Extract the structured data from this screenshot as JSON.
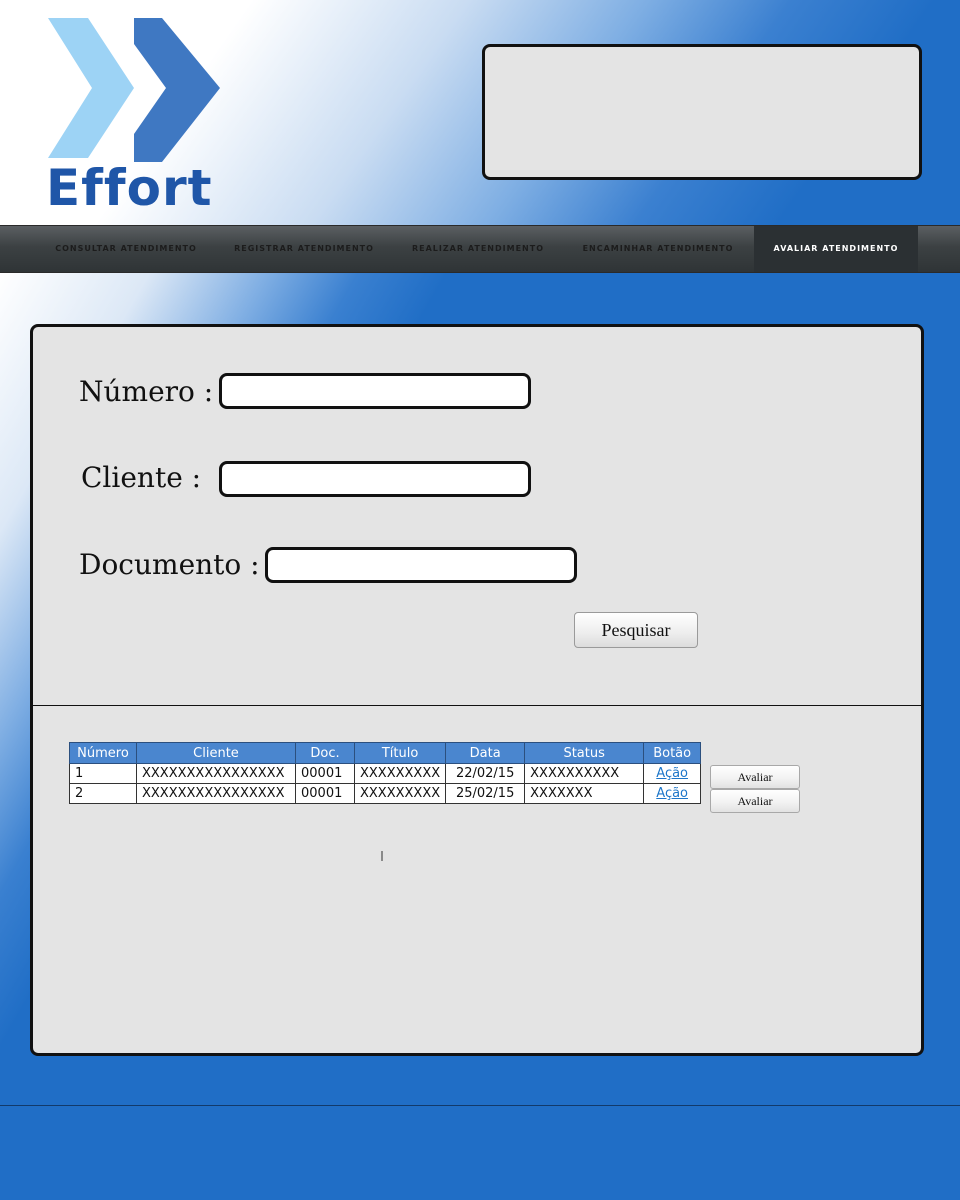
{
  "brand": {
    "name": "Effort",
    "colors": {
      "chevron_light": "#9dd3f5",
      "chevron_dark": "#3f78c2",
      "text": "#1f56a8"
    }
  },
  "nav": {
    "items": [
      {
        "label": "CONSULTAR ATENDIMENTO",
        "active": false
      },
      {
        "label": "REGISTRAR ATENDIMENTO",
        "active": false
      },
      {
        "label": "REALIZAR ATENDIMENTO",
        "active": false
      },
      {
        "label": "ENCAMINHAR ATENDIMENTO",
        "active": false
      },
      {
        "label": "AVALIAR ATENDIMENTO",
        "active": true
      }
    ]
  },
  "form": {
    "numero_label": "Número :",
    "numero_value": "",
    "cliente_label": "Cliente :",
    "cliente_value": "",
    "documento_label": "Documento :",
    "documento_value": "",
    "search_button": "Pesquisar"
  },
  "table": {
    "headers": [
      "Número",
      "Cliente",
      "Doc.",
      "Título",
      "Data",
      "Status",
      "Botão"
    ],
    "rows": [
      {
        "numero": "1",
        "cliente": "XXXXXXXXXXXXXXXX",
        "doc": "00001",
        "titulo": "XXXXXXXXX",
        "data": "22/02/15",
        "status": "XXXXXXXXXX",
        "acao": "Ação",
        "avaliar": "Avaliar"
      },
      {
        "numero": "2",
        "cliente": "XXXXXXXXXXXXXXXX",
        "doc": "00001",
        "titulo": "XXXXXXXXX",
        "data": "25/02/15",
        "status": "XXXXXXX",
        "acao": "Ação",
        "avaliar": "Avaliar"
      }
    ]
  },
  "theme": {
    "background": "#206ec6",
    "panel": "#e4e4e4",
    "navbar": "#3c4143",
    "table_header": "#4a86cf",
    "link": "#1d76c9"
  }
}
